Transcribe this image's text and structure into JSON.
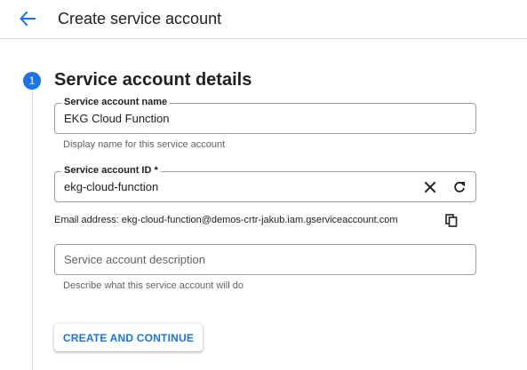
{
  "header": {
    "title": "Create service account",
    "back_icon": "arrow-back-icon"
  },
  "step": {
    "number": "1",
    "title": "Service account details",
    "accent_color": "#1a73e8"
  },
  "form": {
    "name": {
      "label": "Service account name",
      "value": "EKG Cloud Function",
      "hint": "Display name for this service account"
    },
    "id": {
      "label": "Service account ID *",
      "value": "ekg-cloud-function",
      "clear_icon": "close-icon",
      "refresh_icon": "refresh-icon"
    },
    "email": {
      "text": "Email address: ekg-cloud-function@demos-crtr-jakub.iam.gserviceaccount.com",
      "copy_icon": "copy-icon"
    },
    "description": {
      "placeholder": "Service account description",
      "value": "",
      "hint": "Describe what this service account will do"
    }
  },
  "actions": {
    "create_label": "CREATE AND CONTINUE"
  }
}
